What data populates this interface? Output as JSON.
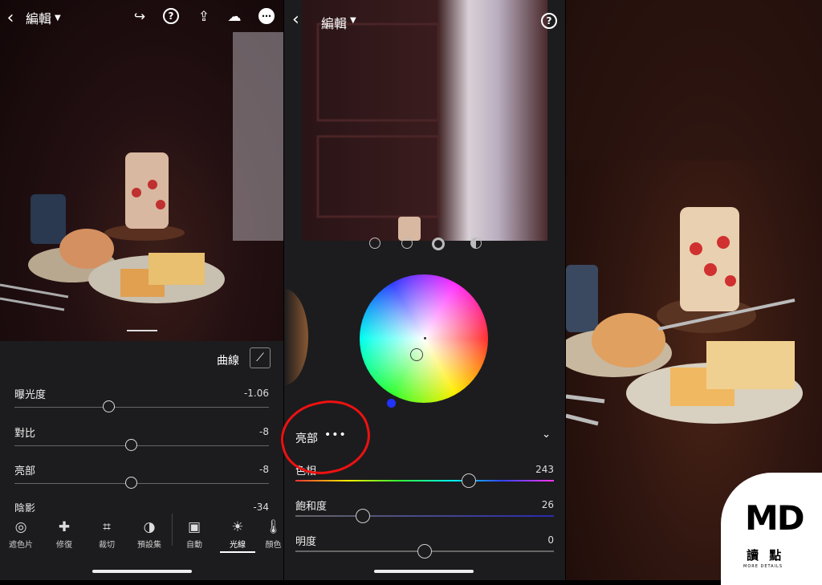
{
  "left": {
    "back_icon": "chevron-left-icon",
    "title": "編輯",
    "curve_label": "曲線",
    "sliders": [
      {
        "label": "曝光度",
        "value": "-1.06",
        "level": 0.37
      },
      {
        "label": "對比",
        "value": "-8",
        "level": 0.46
      },
      {
        "label": "亮部",
        "value": "-8",
        "level": 0.46
      },
      {
        "label": "陰影",
        "value": "-34",
        "level": 0.33
      }
    ],
    "tools": [
      {
        "label": "遮色片",
        "icon": "mask-icon"
      },
      {
        "label": "修復",
        "icon": "bandage-icon"
      },
      {
        "label": "裁切",
        "icon": "crop-icon"
      },
      {
        "label": "預設集",
        "icon": "presets-icon"
      },
      {
        "label": "自動",
        "icon": "auto-icon"
      },
      {
        "label": "光線",
        "icon": "sun-icon"
      },
      {
        "label": "顏色",
        "icon": "thermometer-icon"
      }
    ]
  },
  "mid": {
    "title": "編輯",
    "tone_label": "亮部",
    "sliders": [
      {
        "label": "色相",
        "value": "243",
        "level": 0.67
      },
      {
        "label": "飽和度",
        "value": "26",
        "level": 0.26
      },
      {
        "label": "明度",
        "value": "0",
        "level": 0.5
      }
    ]
  },
  "logo": {
    "mark": "MD",
    "name": "讀 點",
    "tagline": "MORE DETAILS"
  },
  "colors": {
    "accent_blue": "#2233ff",
    "annotation_red": "#e11111"
  }
}
